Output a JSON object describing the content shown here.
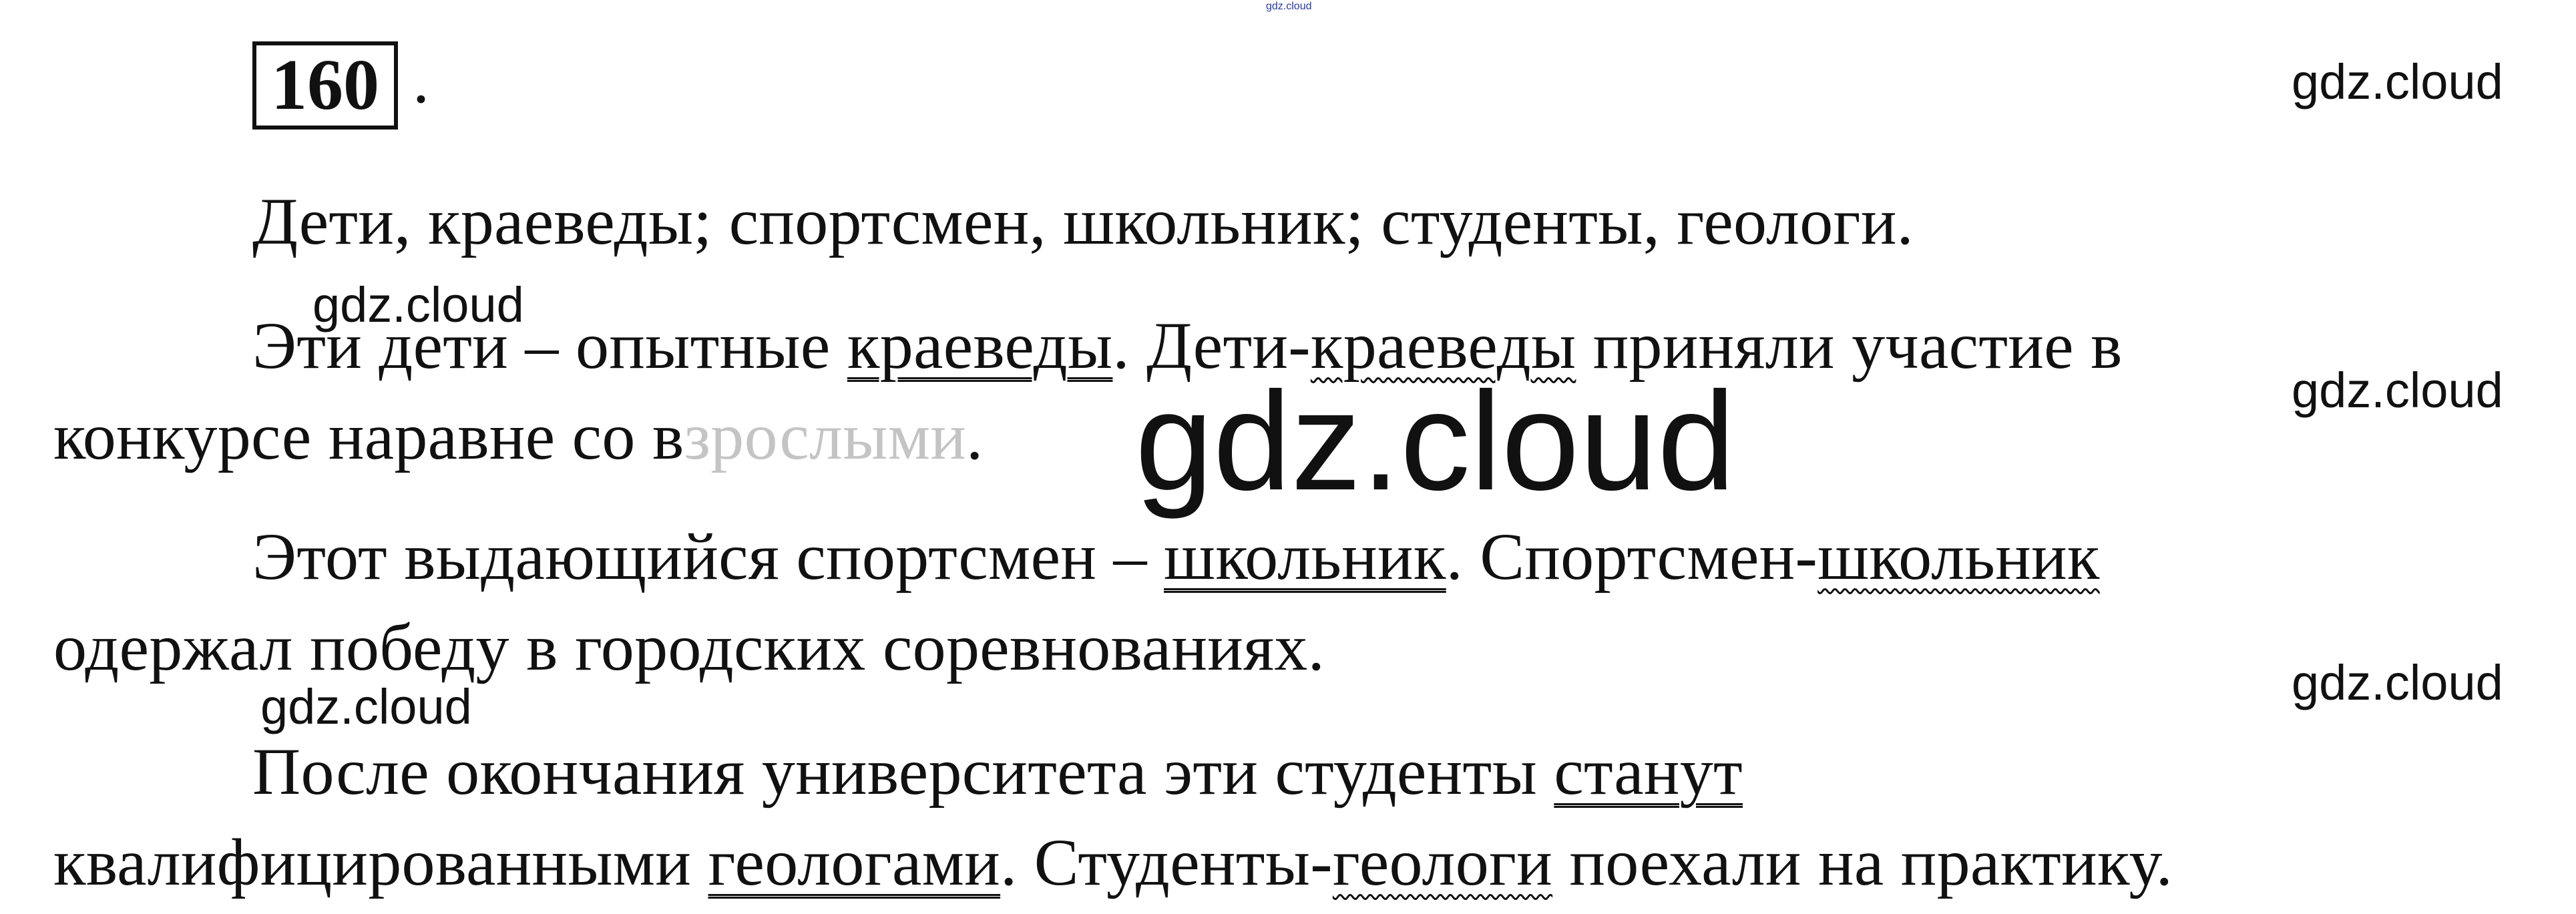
{
  "exercise": {
    "number": "160",
    "dot": "."
  },
  "watermarks": {
    "tiny": "gdz.cloud",
    "right_top": "gdz.cloud",
    "left_mid": "gdz.cloud",
    "right_mid": "gdz.cloud",
    "big_center": "gdz.cloud",
    "right_low": "gdz.cloud",
    "left_low": "gdz.cloud"
  },
  "intro": {
    "text": "Дети, краеведы; спортсмен, школьник; студенты, геологи."
  },
  "p1": {
    "a1": "Эти дети – опытные ",
    "u1": "краеведы",
    "a2": ". Дети-",
    "w1": "краеведы",
    "a3": " приняли участие в",
    "l2a": "конкурсе наравне со в",
    "l2b": "зрослыми",
    "l2c": "."
  },
  "p2": {
    "a1": "Этот выдающийся спортсмен – ",
    "u1": "школьник",
    "a2": ". Спортсмен-",
    "w1": "школьник",
    "l2": "одержал победу в городских соревнованиях."
  },
  "p3": {
    "a1": "После окончания университета эти студенты ",
    "s1": "станут",
    "l2a": "квалифицированными ",
    "u1": "геологами",
    "l2b": ". Студенты-",
    "w1": "геологи",
    "l2c": " поехали на практику."
  }
}
